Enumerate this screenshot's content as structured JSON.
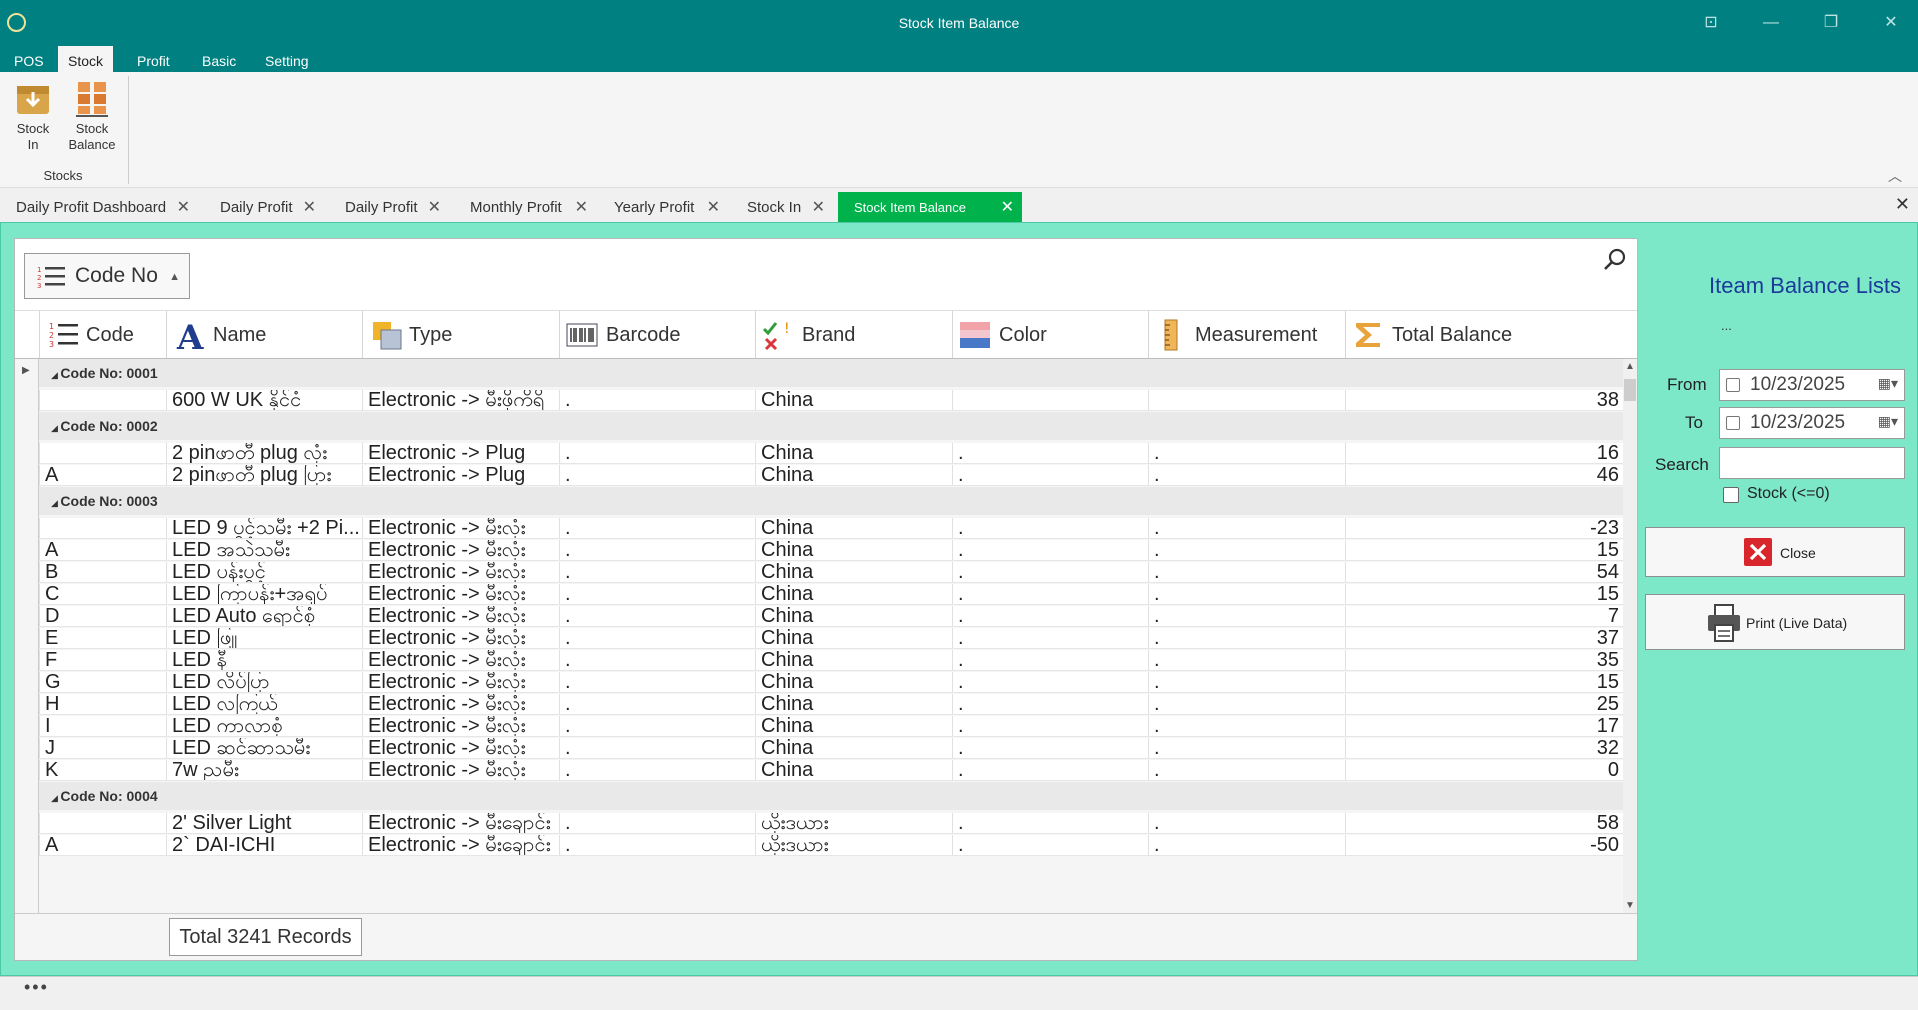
{
  "window": {
    "title": "Stock Item Balance"
  },
  "ribbon_tabs": [
    "POS",
    "Stock",
    "Profit",
    "Basic",
    "Setting"
  ],
  "ribbon": {
    "buttons": [
      {
        "label_line1": "Stock",
        "label_line2": "In"
      },
      {
        "label_line1": "Stock",
        "label_line2": "Balance"
      }
    ],
    "group_label": "Stocks"
  },
  "doc_tabs": [
    "Daily Profit Dashboard",
    "Daily Profit",
    "Daily Profit",
    "Monthly Profit",
    "Yearly Profit",
    "Stock In",
    "Stock Item Balance"
  ],
  "grid": {
    "group_by": "Code No",
    "columns": [
      "Code",
      "Name",
      "Type",
      "Barcode",
      "Brand",
      "Color",
      "Measurement",
      "Total Balance"
    ],
    "rows": [
      {
        "kind": "group",
        "label": "Code No: 0001"
      },
      {
        "kind": "data",
        "code": "",
        "name": "600 W UK နိုင်ငံ",
        "type": "Electronic -> မီးဖိုကိရိ",
        "barcode": ".",
        "brand": "China",
        "color": "",
        "measurement": "",
        "total": "38"
      },
      {
        "kind": "group",
        "label": "Code No: 0002"
      },
      {
        "kind": "data",
        "code": "",
        "name": "2 pinဖာတီ plug လုံး",
        "type": "Electronic -> Plug",
        "barcode": ".",
        "brand": "China",
        "color": ".",
        "measurement": ".",
        "total": "16"
      },
      {
        "kind": "data",
        "code": "A",
        "name": "2 pinဖာတီ plug ပြား",
        "type": "Electronic -> Plug",
        "barcode": ".",
        "brand": "China",
        "color": ".",
        "measurement": ".",
        "total": "46"
      },
      {
        "kind": "group",
        "label": "Code No: 0003"
      },
      {
        "kind": "data",
        "code": "",
        "name": "LED 9 ပွင့်သမီး +2 Pi...",
        "type": "Electronic -> မီးလုံး",
        "barcode": ".",
        "brand": "China",
        "color": ".",
        "measurement": ".",
        "total": "-23"
      },
      {
        "kind": "data",
        "code": "A",
        "name": "LED အသဲသမီး",
        "type": "Electronic -> မီးလုံး",
        "barcode": ".",
        "brand": "China",
        "color": ".",
        "measurement": ".",
        "total": "15"
      },
      {
        "kind": "data",
        "code": "B",
        "name": "LED ပန်းပွင့်",
        "type": "Electronic -> မီးလုံး",
        "barcode": ".",
        "brand": "China",
        "color": ".",
        "measurement": ".",
        "total": "54"
      },
      {
        "kind": "data",
        "code": "C",
        "name": "LED ကြာပန်း+အရုပ်",
        "type": "Electronic -> မီးလုံး",
        "barcode": ".",
        "brand": "China",
        "color": ".",
        "measurement": ".",
        "total": "15"
      },
      {
        "kind": "data",
        "code": "D",
        "name": "LED Auto ရောင်စုံ",
        "type": "Electronic -> မီးလုံး",
        "barcode": ".",
        "brand": "China",
        "color": ".",
        "measurement": ".",
        "total": "7"
      },
      {
        "kind": "data",
        "code": "E",
        "name": "LED ဖြူ",
        "type": "Electronic -> မီးလုံး",
        "barcode": ".",
        "brand": "China",
        "color": ".",
        "measurement": ".",
        "total": "37"
      },
      {
        "kind": "data",
        "code": "F",
        "name": "LED နီ",
        "type": "Electronic -> မီးလုံး",
        "barcode": ".",
        "brand": "China",
        "color": ".",
        "measurement": ".",
        "total": "35"
      },
      {
        "kind": "data",
        "code": "G",
        "name": "LED လိပ်ပြာ",
        "type": "Electronic -> မီးလုံး",
        "barcode": ".",
        "brand": "China",
        "color": ".",
        "measurement": ".",
        "total": "15"
      },
      {
        "kind": "data",
        "code": "H",
        "name": "LED လကြယ်",
        "type": "Electronic -> မီးလုံး",
        "barcode": ".",
        "brand": "China",
        "color": ".",
        "measurement": ".",
        "total": "25"
      },
      {
        "kind": "data",
        "code": "I",
        "name": "LED ကာလာစုံ",
        "type": "Electronic -> မီးလုံး",
        "barcode": ".",
        "brand": "China",
        "color": ".",
        "measurement": ".",
        "total": "17"
      },
      {
        "kind": "data",
        "code": "J",
        "name": "LED ဆင်ဆာသမီး",
        "type": "Electronic -> မီးလုံး",
        "barcode": ".",
        "brand": "China",
        "color": ".",
        "measurement": ".",
        "total": "32"
      },
      {
        "kind": "data",
        "code": "K",
        "name": "7w ညမီး",
        "type": "Electronic -> မီးလုံး",
        "barcode": ".",
        "brand": "China",
        "color": ".",
        "measurement": ".",
        "total": "0"
      },
      {
        "kind": "group",
        "label": "Code No: 0004"
      },
      {
        "kind": "data",
        "code": "",
        "name": "2' Silver Light",
        "type": "Electronic -> မီးချောင်း",
        "barcode": ".",
        "brand": "ယိုးဒယား",
        "color": ".",
        "measurement": ".",
        "total": "58"
      },
      {
        "kind": "data",
        "code": "A",
        "name": "2` DAI-ICHI",
        "type": "Electronic -> မီးချောင်း",
        "barcode": ".",
        "brand": "ယိုးဒယား",
        "color": ".",
        "measurement": ".",
        "total": "-50"
      }
    ],
    "footer_total": "Total 3241 Records"
  },
  "side": {
    "heading": "Iteam Balance Lists",
    "dots": "...",
    "from_label": "From",
    "from_value": "10/23/2025",
    "to_label": "To",
    "to_value": "10/23/2025",
    "search_label": "Search",
    "search_value": "",
    "stock_check_label": "Stock (<=0)",
    "close_label": "Close",
    "print_label": "Print (Live Data)"
  },
  "status": {
    "dots": "•••"
  },
  "colors": {
    "titlebar": "#008080",
    "active_tab": "#00b24b",
    "content_bg": "#7de8c8",
    "heading": "#1a3b9a"
  }
}
